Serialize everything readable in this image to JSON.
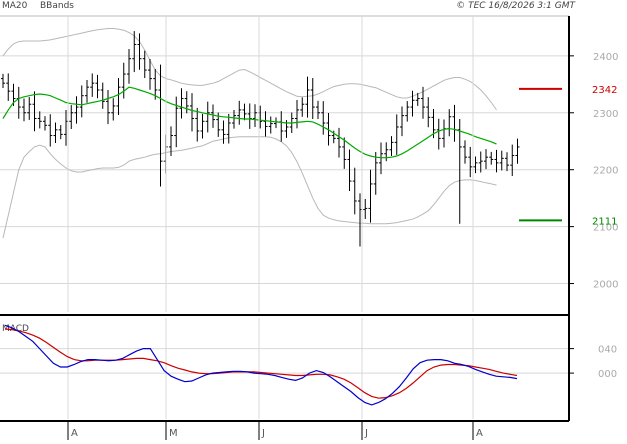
{
  "header": {
    "legend": [
      {
        "label": "MA20",
        "color": "#00aa00"
      },
      {
        "label": "BBands",
        "color": "#b0b0b0"
      }
    ],
    "copyright": "© TEC 16/8/2026 3:1 GMT"
  },
  "macd_label": "MACD",
  "chart_data": {
    "type": "line",
    "price_panel": {
      "ylim": [
        1950,
        2470
      ],
      "yticks": [
        2000,
        2100,
        2200,
        2300,
        2400
      ],
      "ytick_labels": [
        "2000",
        "2100",
        "2200",
        "2300",
        "2400"
      ],
      "close": [
        2352,
        2338,
        2325,
        2310,
        2300,
        2315,
        2290,
        2285,
        2278,
        2260,
        2270,
        2262,
        2285,
        2300,
        2310,
        2330,
        2345,
        2352,
        2340,
        2320,
        2300,
        2312,
        2345,
        2368,
        2395,
        2420,
        2395,
        2375,
        2360,
        2340,
        2215,
        2240,
        2260,
        2308,
        2325,
        2312,
        2290,
        2268,
        2285,
        2300,
        2288,
        2270,
        2262,
        2282,
        2295,
        2305,
        2298,
        2290,
        2300,
        2285,
        2276,
        2281,
        2284,
        2268,
        2275,
        2290,
        2305,
        2315,
        2340,
        2310,
        2300,
        2282,
        2260,
        2255,
        2240,
        2218,
        2180,
        2145,
        2130,
        2132,
        2175,
        2212,
        2228,
        2235,
        2248,
        2275,
        2295,
        2310,
        2322,
        2325,
        2310,
        2292,
        2270,
        2255,
        2272,
        2293,
        2270,
        2240,
        2222,
        2205,
        2212,
        2215,
        2222,
        2218,
        2212,
        2220,
        2208,
        2225,
        2240
      ],
      "ma20": [
        2290,
        2305,
        2318,
        2325,
        2328,
        2330,
        2332,
        2333,
        2332,
        2330,
        2326,
        2322,
        2318,
        2316,
        2315,
        2314,
        2316,
        2318,
        2320,
        2322,
        2325,
        2328,
        2332,
        2338,
        2345,
        2343,
        2340,
        2337,
        2334,
        2330,
        2325,
        2320,
        2316,
        2313,
        2310,
        2307,
        2304,
        2302,
        2300,
        2298,
        2296,
        2294,
        2293,
        2292,
        2291,
        2290,
        2289,
        2289,
        2288,
        2287,
        2286,
        2285,
        2284,
        2283,
        2282,
        2282,
        2283,
        2284,
        2285,
        2284,
        2280,
        2275,
        2270,
        2264,
        2258,
        2252,
        2245,
        2238,
        2232,
        2227,
        2224,
        2222,
        2221,
        2221,
        2222,
        2224,
        2228,
        2233,
        2239,
        2245,
        2251,
        2257,
        2263,
        2268,
        2271,
        2272,
        2271,
        2268,
        2265,
        2262,
        2258,
        2255,
        2252,
        2249,
        2245
      ],
      "bb_upper": [
        2400,
        2412,
        2421,
        2425,
        2426,
        2426,
        2426,
        2426,
        2427,
        2428,
        2430,
        2432,
        2434,
        2436,
        2438,
        2440,
        2442,
        2444,
        2446,
        2447,
        2448,
        2448,
        2447,
        2445,
        2441,
        2435,
        2425,
        2410,
        2392,
        2375,
        2365,
        2360,
        2358,
        2355,
        2352,
        2350,
        2349,
        2348,
        2348,
        2350,
        2352,
        2355,
        2360,
        2365,
        2370,
        2375,
        2376,
        2372,
        2367,
        2362,
        2357,
        2352,
        2347,
        2342,
        2337,
        2333,
        2329,
        2328,
        2329,
        2330,
        2333,
        2337,
        2342,
        2346,
        2348,
        2350,
        2351,
        2351,
        2350,
        2348,
        2346,
        2344,
        2340,
        2336,
        2332,
        2328,
        2326,
        2326,
        2329,
        2333,
        2337,
        2342,
        2347,
        2352,
        2357,
        2360,
        2362,
        2362,
        2359,
        2355,
        2348,
        2340,
        2330,
        2318,
        2305
      ],
      "bb_lower": [
        2080,
        2120,
        2160,
        2200,
        2222,
        2232,
        2240,
        2243,
        2240,
        2228,
        2218,
        2210,
        2203,
        2198,
        2196,
        2196,
        2198,
        2200,
        2202,
        2203,
        2203,
        2203,
        2204,
        2208,
        2215,
        2218,
        2220,
        2222,
        2225,
        2227,
        2228,
        2230,
        2232,
        2233,
        2234,
        2236,
        2238,
        2240,
        2242,
        2246,
        2250,
        2252,
        2254,
        2256,
        2257,
        2258,
        2258,
        2258,
        2258,
        2258,
        2258,
        2257,
        2254,
        2249,
        2242,
        2230,
        2214,
        2194,
        2172,
        2150,
        2132,
        2120,
        2115,
        2112,
        2110,
        2109,
        2108,
        2107,
        2106,
        2106,
        2105,
        2105,
        2105,
        2105,
        2106,
        2107,
        2109,
        2111,
        2113,
        2117,
        2122,
        2128,
        2138,
        2150,
        2162,
        2172,
        2178,
        2181,
        2182,
        2182,
        2181,
        2179,
        2177,
        2175,
        2173
      ],
      "levels": [
        {
          "value": 2342,
          "label": "2342",
          "color": "#cc0000"
        },
        {
          "value": 2111,
          "label": "2111",
          "color": "#008800"
        }
      ]
    },
    "macd_panel": {
      "ylim": [
        -0.75,
        0.9
      ],
      "yticks": [
        0.4,
        0.0
      ],
      "ytick_labels": [
        "040",
        "000"
      ],
      "macd": [
        0.78,
        0.74,
        0.68,
        0.6,
        0.52,
        0.4,
        0.28,
        0.16,
        0.1,
        0.1,
        0.14,
        0.19,
        0.22,
        0.22,
        0.21,
        0.2,
        0.21,
        0.24,
        0.3,
        0.36,
        0.4,
        0.4,
        0.22,
        0.04,
        -0.05,
        -0.1,
        -0.14,
        -0.13,
        -0.08,
        -0.03,
        0.0,
        0.01,
        0.02,
        0.03,
        0.03,
        0.02,
        0.0,
        -0.01,
        -0.02,
        -0.04,
        -0.07,
        -0.1,
        -0.12,
        -0.08,
        0.0,
        0.04,
        0.01,
        -0.06,
        -0.14,
        -0.22,
        -0.3,
        -0.4,
        -0.48,
        -0.52,
        -0.48,
        -0.42,
        -0.33,
        -0.22,
        -0.08,
        0.07,
        0.17,
        0.21,
        0.22,
        0.22,
        0.2,
        0.16,
        0.14,
        0.11,
        0.06,
        0.02,
        -0.02,
        -0.05,
        -0.06,
        -0.07,
        -0.09
      ],
      "signal": [
        0.72,
        0.71,
        0.69,
        0.66,
        0.62,
        0.57,
        0.5,
        0.42,
        0.34,
        0.27,
        0.22,
        0.2,
        0.2,
        0.21,
        0.21,
        0.21,
        0.21,
        0.22,
        0.23,
        0.24,
        0.24,
        0.22,
        0.2,
        0.17,
        0.12,
        0.08,
        0.05,
        0.02,
        0.0,
        -0.01,
        -0.01,
        0.0,
        0.01,
        0.02,
        0.02,
        0.02,
        0.02,
        0.01,
        0.0,
        -0.01,
        -0.02,
        -0.03,
        -0.04,
        -0.04,
        -0.03,
        -0.02,
        -0.02,
        -0.03,
        -0.06,
        -0.1,
        -0.16,
        -0.24,
        -0.32,
        -0.38,
        -0.41,
        -0.4,
        -0.37,
        -0.32,
        -0.25,
        -0.16,
        -0.06,
        0.04,
        0.1,
        0.13,
        0.14,
        0.14,
        0.13,
        0.12,
        0.1,
        0.08,
        0.06,
        0.03,
        0.0,
        -0.02,
        -0.04
      ]
    },
    "x_labels": [
      "A",
      "M",
      "J",
      "J",
      "A"
    ],
    "grid": true
  }
}
